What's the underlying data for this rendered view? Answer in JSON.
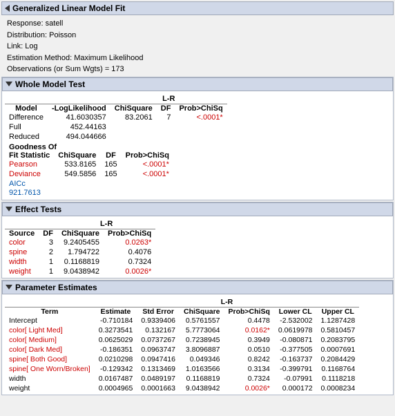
{
  "title": "Generalized Linear Model Fit",
  "meta": {
    "response": "Response: satell",
    "distribution": "Distribution: Poisson",
    "link": "Link: Log",
    "estimation": "Estimation Method: Maximum Likelihood",
    "observations": "Observations (or Sum Wgts) = 173"
  },
  "whole_model": {
    "header": "Whole Model Test",
    "lr_label": "L-R",
    "columns": [
      "Model",
      "-LogLikelihood",
      "ChiSquare",
      "DF",
      "Prob>ChiSq"
    ],
    "rows": [
      {
        "model": "Difference",
        "loglike": "41.6030357",
        "chisq": "83.2061",
        "df": "7",
        "prob": "<.0001*",
        "prob_red": true
      },
      {
        "model": "Full",
        "loglike": "452.44163",
        "chisq": "",
        "df": "",
        "prob": "",
        "prob_red": false
      },
      {
        "model": "Reduced",
        "loglike": "494.044666",
        "chisq": "",
        "df": "",
        "prob": "",
        "prob_red": false
      }
    ],
    "goodness_header": "Goodness Of",
    "fit_statistic": "Fit Statistic",
    "goodness_columns": [
      "ChiSquare",
      "DF",
      "Prob>ChiSq"
    ],
    "goodness_rows": [
      {
        "stat": "Pearson",
        "chisq": "533.8165",
        "df": "165",
        "prob": "<.0001*",
        "prob_red": true
      },
      {
        "stat": "Deviance",
        "chisq": "549.5856",
        "df": "165",
        "prob": "<.0001*",
        "prob_red": true
      }
    ],
    "aicc_label": "AICc",
    "aicc_value": "921.7613"
  },
  "effect_tests": {
    "header": "Effect Tests",
    "lr_label": "L-R",
    "columns": [
      "Source",
      "DF",
      "ChiSquare",
      "Prob>ChiSq"
    ],
    "rows": [
      {
        "source": "color",
        "df": "3",
        "chisq": "9.2405455",
        "prob": "0.0263*",
        "prob_red": true
      },
      {
        "source": "spine",
        "df": "2",
        "chisq": "1.794722",
        "prob": "0.4076",
        "prob_red": false
      },
      {
        "source": "width",
        "df": "1",
        "chisq": "0.1168819",
        "prob": "0.7324",
        "prob_red": false
      },
      {
        "source": "weight",
        "df": "1",
        "chisq": "9.0438942",
        "prob": "0.0026*",
        "prob_red": true
      }
    ]
  },
  "parameter_estimates": {
    "header": "Parameter Estimates",
    "lr_label": "L-R",
    "columns": [
      "Term",
      "Estimate",
      "Std Error",
      "ChiSquare",
      "Prob>ChiSq",
      "Lower CL",
      "Upper CL"
    ],
    "rows": [
      {
        "term": "Intercept",
        "estimate": "-0.710184",
        "stderr": "0.9339406",
        "chisq": "0.5761557",
        "prob": "0.4478",
        "lower": "-2.532002",
        "upper": "1.1287428",
        "prob_red": false,
        "term_red": false
      },
      {
        "term": "color[ Light Med]",
        "estimate": "0.3273541",
        "stderr": "0.132167",
        "chisq": "5.7773064",
        "prob": "0.0162*",
        "lower": "0.0619978",
        "upper": "0.5810457",
        "prob_red": true,
        "term_red": true
      },
      {
        "term": "color[ Medium]",
        "estimate": "0.0625029",
        "stderr": "0.0737267",
        "chisq": "0.7238945",
        "prob": "0.3949",
        "lower": "-0.080871",
        "upper": "0.2083795",
        "prob_red": false,
        "term_red": true
      },
      {
        "term": "color[ Dark Med]",
        "estimate": "-0.186351",
        "stderr": "0.0963747",
        "chisq": "3.8096887",
        "prob": "0.0510",
        "lower": "-0.377505",
        "upper": "0.0007691",
        "prob_red": false,
        "term_red": true
      },
      {
        "term": "spine[ Both Good]",
        "estimate": "0.0210298",
        "stderr": "0.0947416",
        "chisq": "0.049346",
        "prob": "0.8242",
        "lower": "-0.163737",
        "upper": "0.2084429",
        "prob_red": false,
        "term_red": true
      },
      {
        "term": "spine[ One Worn/Broken]",
        "estimate": "-0.129342",
        "stderr": "0.1313469",
        "chisq": "1.0163566",
        "prob": "0.3134",
        "lower": "-0.399791",
        "upper": "0.1168764",
        "prob_red": false,
        "term_red": true
      },
      {
        "term": "width",
        "estimate": "0.0167487",
        "stderr": "0.0489197",
        "chisq": "0.1168819",
        "prob": "0.7324",
        "lower": "-0.07991",
        "upper": "0.1118218",
        "prob_red": false,
        "term_red": false
      },
      {
        "term": "weight",
        "estimate": "0.0004965",
        "stderr": "0.0001663",
        "chisq": "9.0438942",
        "prob": "0.0026*",
        "lower": "0.000172",
        "upper": "0.0008234",
        "prob_red": true,
        "term_red": false
      }
    ]
  }
}
